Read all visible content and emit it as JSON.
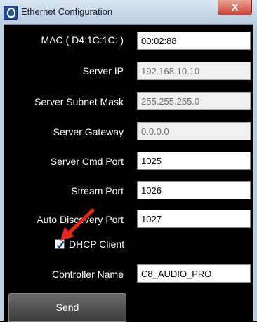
{
  "window": {
    "title": "Ethernet Configuration",
    "close_symbol": "X"
  },
  "form": {
    "mac": {
      "label": "MAC ( D4:1C:1C: )",
      "value": "00:02:88"
    },
    "server_ip": {
      "label": "Server IP",
      "value": "192.168.10.10"
    },
    "subnet": {
      "label": "Server Subnet Mask",
      "value": "255.255.255.0"
    },
    "gateway": {
      "label": "Server Gateway",
      "value": "0.0.0.0"
    },
    "cmd_port": {
      "label": "Server Cmd Port",
      "value": "1025"
    },
    "stream_port": {
      "label": "Stream Port",
      "value": "1026"
    },
    "discovery": {
      "label": "Auto Discovery Port",
      "value": "1027"
    },
    "dhcp": {
      "label": "DHCP Client",
      "checked": true
    },
    "controller": {
      "label": "Controller Name",
      "value": "C8_AUDIO_PRO"
    }
  },
  "send_label": "Send",
  "colors": {
    "background": "#000000",
    "annotation_arrow": "#e8261c",
    "checkbox_check": "#1f3f9c"
  }
}
